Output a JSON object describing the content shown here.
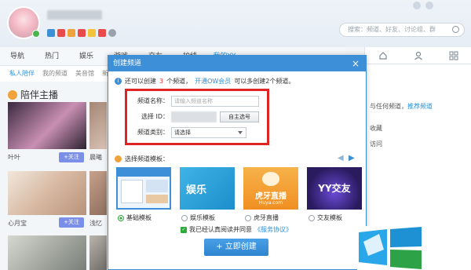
{
  "profile": {
    "avatar": "user-avatar",
    "online_icon": "check-icon"
  },
  "search": {
    "placeholder": "搜索：频道、好友、讨论组、群"
  },
  "nav": {
    "items": [
      "导航",
      "热门",
      "娱乐",
      "游戏",
      "交友",
      "护线",
      "我的YY"
    ]
  },
  "subnav": {
    "items": [
      "私人陪伴",
      "我的频道",
      "美音馆",
      "新"
    ]
  },
  "left": {
    "section_title": "陪伴主播",
    "cards": [
      {
        "name": "叶叶",
        "follow": "+关注"
      },
      {
        "name": "晨曦",
        "follow": "+关注"
      },
      {
        "name": "心月宝",
        "follow": "+关注"
      },
      {
        "name": "浅忆",
        "follow": "+关注"
      }
    ]
  },
  "rightpanel": {
    "lines": [
      "与任何频道，",
      "推荐频道",
      "收藏",
      "访问"
    ]
  },
  "dialog": {
    "title": "创建频道",
    "close": "×",
    "tip_prefix": "还可以创建",
    "tip_count": "3",
    "tip_mid": "个频道，",
    "tip_link": "开通OW会员",
    "tip_suffix": "可以多创建2个频道。",
    "form": {
      "name_label": "频道名称：",
      "name_placeholder": "请输入频道名称",
      "id_label": "选择 ID：",
      "id_button": "自主选号",
      "type_label": "频道类别：",
      "type_value": "请选择"
    },
    "template_title": "选择频道模板：",
    "templates": [
      {
        "label": "基础模板",
        "selected": true
      },
      {
        "label": "娱乐模板",
        "selected": false
      },
      {
        "label": "虎牙直播",
        "selected": false
      },
      {
        "label": "交友模板",
        "selected": false
      }
    ],
    "template_texts": {
      "yule": "娱乐",
      "huya": "虎牙直播",
      "huya_url": "Huya.com",
      "yy": "YY交友"
    },
    "agree_text": "我已经认真阅读并同意",
    "agree_link": "《服务协议》",
    "create_button": "+ 立即创建"
  },
  "colors": {
    "accent": "#3d8fd8",
    "highlight_frame": "#e02424",
    "success": "#2eaa3b"
  }
}
